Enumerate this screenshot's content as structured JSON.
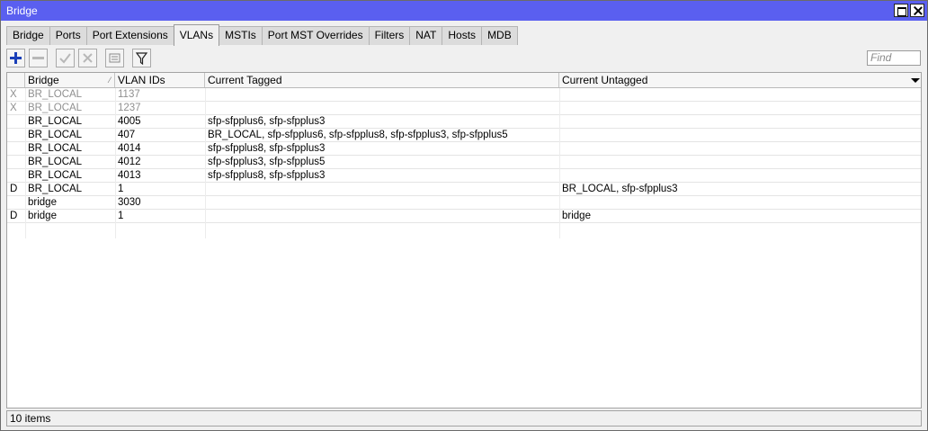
{
  "window": {
    "title": "Bridge"
  },
  "tabs": [
    "Bridge",
    "Ports",
    "Port Extensions",
    "VLANs",
    "MSTIs",
    "Port MST Overrides",
    "Filters",
    "NAT",
    "Hosts",
    "MDB"
  ],
  "active_tab": "VLANs",
  "search": {
    "placeholder": "Find"
  },
  "columns": {
    "flags": "",
    "bridge": "Bridge",
    "vlan_ids": "VLAN IDs",
    "current_tagged": "Current Tagged",
    "current_untagged": "Current Untagged"
  },
  "rows": [
    {
      "flag": "X",
      "bridge": "BR_LOCAL",
      "vlan_ids": "1137",
      "tagged": "",
      "untagged": "",
      "disabled": true
    },
    {
      "flag": "X",
      "bridge": "BR_LOCAL",
      "vlan_ids": "1237",
      "tagged": "",
      "untagged": "",
      "disabled": true
    },
    {
      "flag": "",
      "bridge": "BR_LOCAL",
      "vlan_ids": "4005",
      "tagged": "sfp-sfpplus6, sfp-sfpplus3",
      "untagged": ""
    },
    {
      "flag": "",
      "bridge": "BR_LOCAL",
      "vlan_ids": "407",
      "tagged": "BR_LOCAL, sfp-sfpplus6, sfp-sfpplus8, sfp-sfpplus3, sfp-sfpplus5",
      "untagged": ""
    },
    {
      "flag": "",
      "bridge": "BR_LOCAL",
      "vlan_ids": "4014",
      "tagged": "sfp-sfpplus8, sfp-sfpplus3",
      "untagged": ""
    },
    {
      "flag": "",
      "bridge": "BR_LOCAL",
      "vlan_ids": "4012",
      "tagged": "sfp-sfpplus3, sfp-sfpplus5",
      "untagged": ""
    },
    {
      "flag": "",
      "bridge": "BR_LOCAL",
      "vlan_ids": "4013",
      "tagged": "sfp-sfpplus8, sfp-sfpplus3",
      "untagged": ""
    },
    {
      "flag": "D",
      "bridge": "BR_LOCAL",
      "vlan_ids": "1",
      "tagged": "",
      "untagged": "BR_LOCAL, sfp-sfpplus3"
    },
    {
      "flag": "",
      "bridge": "bridge",
      "vlan_ids": "3030",
      "tagged": "",
      "untagged": ""
    },
    {
      "flag": "D",
      "bridge": "bridge",
      "vlan_ids": "1",
      "tagged": "",
      "untagged": "bridge"
    }
  ],
  "status": {
    "items": "10 items"
  },
  "icons": [
    "add-icon",
    "remove-icon",
    "enable-icon",
    "disable-icon",
    "comment-icon",
    "filter-icon"
  ],
  "colors": {
    "titlebar": "#5a5ff0",
    "disabled_text": "#8f8f8f",
    "add_icon": "#1a3fb8"
  }
}
